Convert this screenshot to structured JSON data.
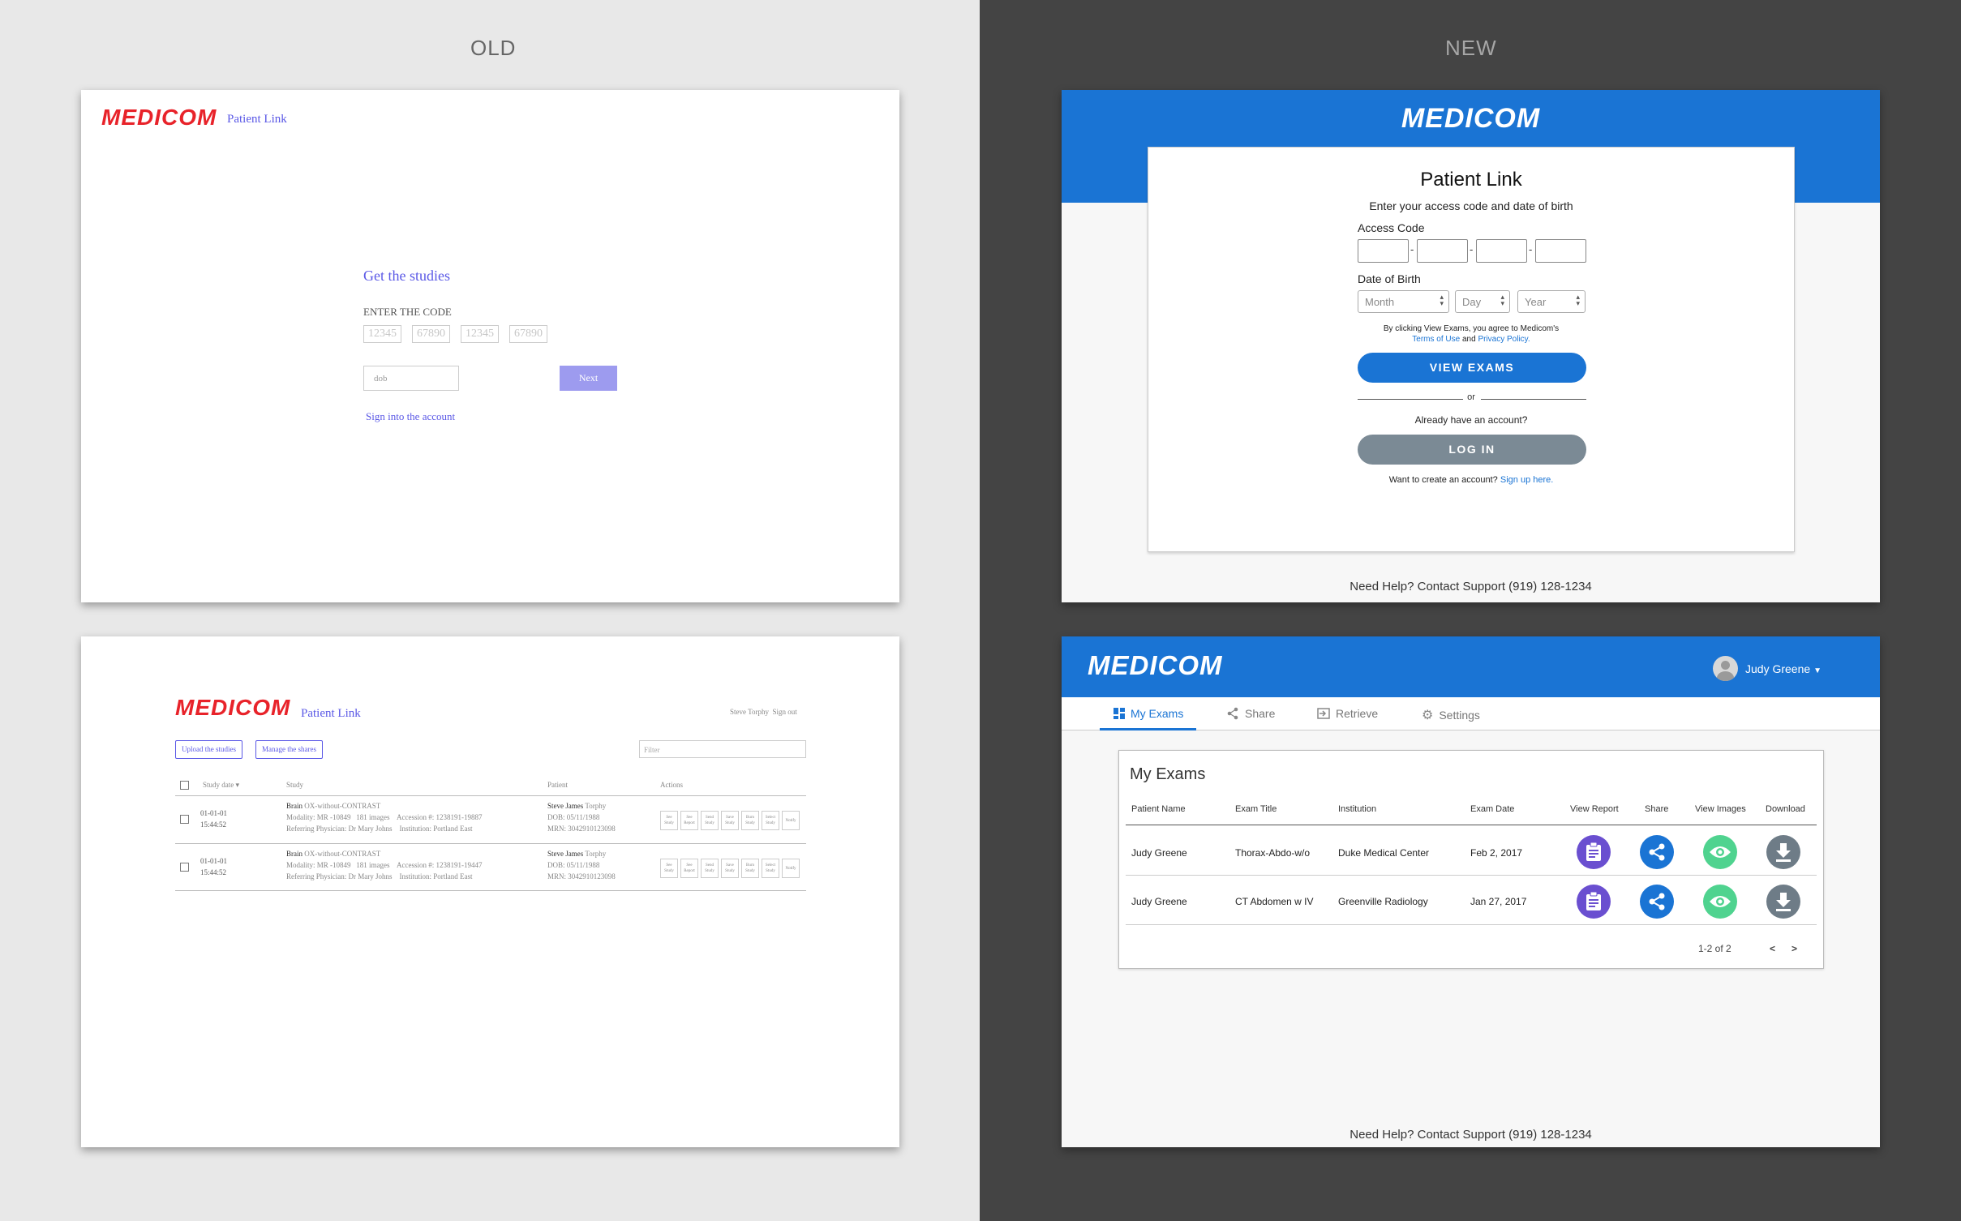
{
  "labels": {
    "old": "OLD",
    "new": "NEW"
  },
  "colors": {
    "medicom_red": "#e8232a",
    "old_accent": "#5a58e6",
    "new_blue": "#1a74d4",
    "login_gray": "#7b8a95",
    "dark_bg": "#444444"
  },
  "old_login": {
    "logo": "MEDICOM",
    "app_name": "Patient Link",
    "heading": "Get the studies",
    "code_label": "ENTER THE CODE",
    "code_placeholders": [
      "12345",
      "67890",
      "12345",
      "67890"
    ],
    "dob_placeholder": "dob",
    "next_label": "Next",
    "sign_in_link": "Sign into the account"
  },
  "old_list": {
    "logo": "MEDICOM",
    "app_name": "Patient Link",
    "user": "Steve Torphy",
    "sign_out": "Sign out",
    "upload_btn": "Upload the studies",
    "manage_btn": "Manage the shares",
    "filter_placeholder": "Filter",
    "columns": {
      "date": "Study date",
      "study": "Study",
      "patient": "Patient",
      "actions": "Actions"
    },
    "rows": [
      {
        "date": "01-01-01",
        "time": "15:44:52",
        "study_name": "Brain",
        "study_desc": "OX-without-CONTRAST",
        "modality": "Modality: MR -10849",
        "images": "181 images",
        "accession": "Accession #: 1238191-19887",
        "referring": "Referring Physician: Dr Mary Johns",
        "institution": "Institution: Portland East",
        "patient_first": "Steve James",
        "patient_last": "Torphy",
        "dob": "DOB: 05/11/1988",
        "mrn": "MRN: 3042910123098"
      },
      {
        "date": "01-01-01",
        "time": "15:44:52",
        "study_name": "Brain",
        "study_desc": "OX-without-CONTRAST",
        "modality": "Modality: MR -10849",
        "images": "181 images",
        "accession": "Accession #: 1238191-19447",
        "referring": "Referring Physician: Dr Mary Johns",
        "institution": "Institution: Portland East",
        "patient_first": "Steve James",
        "patient_last": "Torphy",
        "dob": "DOB: 05/11/1988",
        "mrn": "MRN: 3042910123098"
      }
    ],
    "actions": [
      [
        "See",
        "Study"
      ],
      [
        "See",
        "Report"
      ],
      [
        "Send",
        "Study"
      ],
      [
        "Save",
        "Study"
      ],
      [
        "Burn",
        "Study"
      ],
      [
        "Select",
        "Study"
      ],
      [
        "Notify",
        ""
      ]
    ]
  },
  "new_login": {
    "logo": "MEDICOM",
    "title": "Patient Link",
    "subtitle": "Enter your access code and date of birth",
    "access_code_label": "Access Code",
    "dob_label": "Date of Birth",
    "month": "Month",
    "day": "Day",
    "year": "Year",
    "agree_text": "By clicking View Exams, you agree to Medicom's",
    "terms": "Terms of Use",
    "and": "and",
    "privacy": "Privacy Policy.",
    "view_exams": "VIEW EXAMS",
    "or": "or",
    "already": "Already have an account?",
    "log_in": "LOG IN",
    "create": "Want to create an account?",
    "sign_up": "Sign up here.",
    "help": "Need Help? Contact Support (919) 128-1234"
  },
  "new_exams": {
    "logo": "MEDICOM",
    "user": "Judy Greene",
    "tabs": [
      "My Exams",
      "Share",
      "Retrieve",
      "Settings"
    ],
    "title": "My Exams",
    "columns": [
      "Patient Name",
      "Exam Title",
      "Institution",
      "Exam Date",
      "View Report",
      "Share",
      "View Images",
      "Download"
    ],
    "rows": [
      {
        "patient": "Judy Greene",
        "exam": "Thorax-Abdo-w/o",
        "institution": "Duke Medical Center",
        "date": "Feb 2, 2017"
      },
      {
        "patient": "Judy Greene",
        "exam": "CT Abdomen w IV",
        "institution": "Greenville Radiology",
        "date": "Jan 27, 2017"
      }
    ],
    "icon_colors": {
      "report": "#6a4fd0",
      "share": "#1a74d4",
      "images": "#4fd38f",
      "download": "#6e7c87"
    },
    "pagination": "1-2 of 2",
    "prev": "<",
    "next": ">",
    "help": "Need Help? Contact Support (919) 128-1234"
  }
}
